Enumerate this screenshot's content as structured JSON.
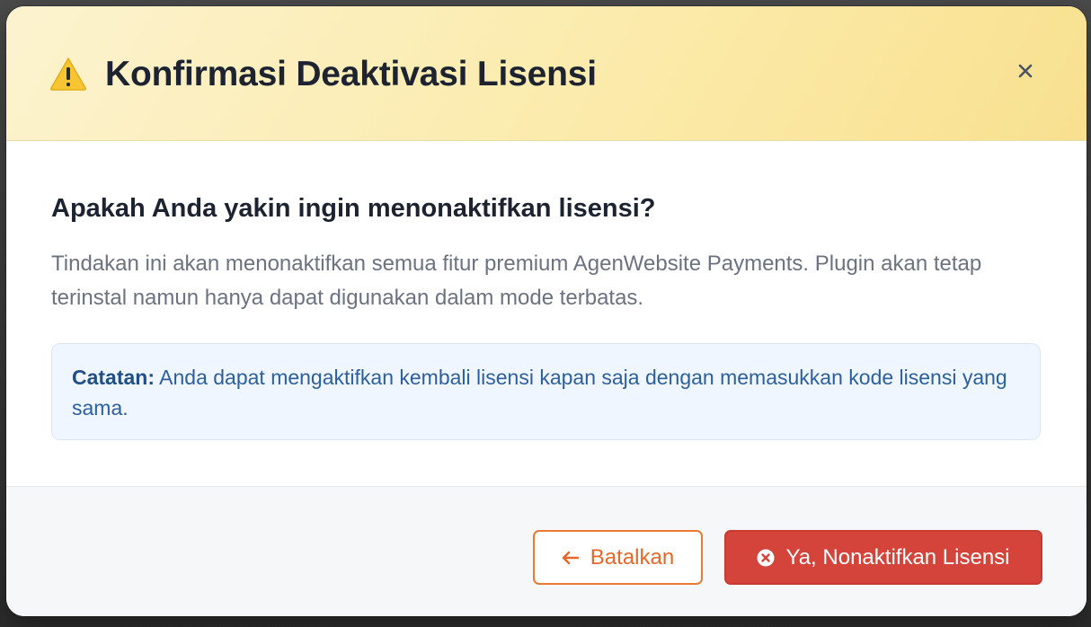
{
  "dialog": {
    "title": "Konfirmasi Deaktivasi Lisensi",
    "title_icon": "warning-icon",
    "close_label": "×",
    "close_icon": "close-icon"
  },
  "body": {
    "question": "Apakah Anda yakin ingin menonaktifkan lisensi?",
    "description": "Tindakan ini akan menonaktifkan semua fitur premium AgenWebsite Payments. Plugin akan tetap terinstal namun hanya dapat digunakan dalam mode terbatas.",
    "note": {
      "label": "Catatan:",
      "text": "Anda dapat mengaktifkan kembali lisensi kapan saja dengan memasukkan kode lisensi yang sama."
    }
  },
  "footer": {
    "cancel_label": "Batalkan",
    "cancel_icon": "arrow-left-icon",
    "confirm_label": "Ya, Nonaktifkan Lisensi",
    "confirm_icon": "x-circle-icon"
  },
  "colors": {
    "header_bg": "#fbeaa8",
    "danger": "#d4443b",
    "cancel_accent": "#ec7a35",
    "note_bg": "#eff6ff",
    "note_text": "#2c5f9e"
  }
}
